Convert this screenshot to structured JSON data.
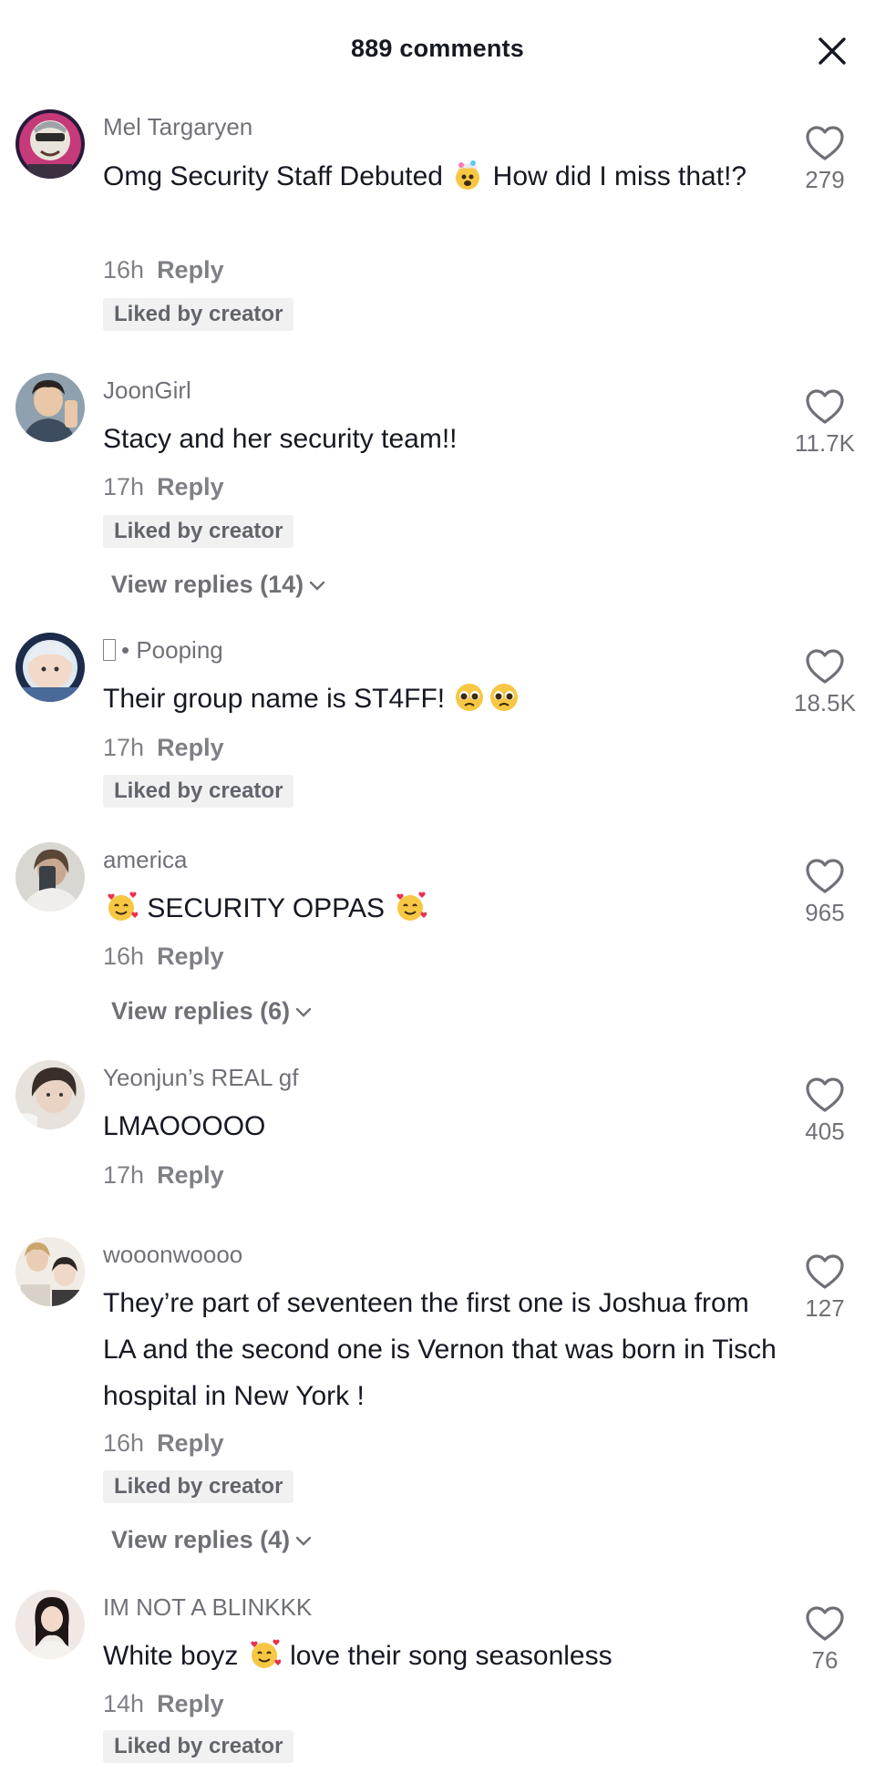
{
  "header": {
    "title": "889 comments"
  },
  "comments": [
    {
      "username": "Mel Targaryen",
      "text_a": "Omg Security Staff Debuted",
      "text_b": " How did I miss that!?",
      "time": "16h",
      "reply": "Reply",
      "liked_label": "Liked by creator",
      "likes": "279"
    },
    {
      "username": "JoonGirl",
      "text_a": "Stacy and her security team!!",
      "time": "17h",
      "reply": "Reply",
      "liked_label": "Liked by creator",
      "view_replies": "View replies (14)",
      "likes": "11.7K"
    },
    {
      "username": "• Pooping",
      "text_a": "Their group name is ST4FF! ",
      "time": "17h",
      "reply": "Reply",
      "liked_label": "Liked by creator",
      "likes": "18.5K"
    },
    {
      "username": "america",
      "text_a": " SECURITY OPPAS ",
      "time": "16h",
      "reply": "Reply",
      "view_replies": "View replies (6)",
      "likes": "965"
    },
    {
      "username": "Yeonjun’s REAL gf",
      "text_a": "LMAOOOOO",
      "time": "17h",
      "reply": "Reply",
      "likes": "405"
    },
    {
      "username": "wooonwoooo",
      "text_a": "They’re part of seventeen the first one is Joshua from LA and the second one is Vernon that was born in Tisch hospital in New York !",
      "time": "16h",
      "reply": "Reply",
      "liked_label": "Liked by creator",
      "view_replies": "View replies (4)",
      "likes": "127"
    },
    {
      "username": "IM NOT A BLINKKK",
      "text_a": "White boyz ",
      "text_b": " love their song seasonless",
      "time": "14h",
      "reply": "Reply",
      "liked_label": "Liked by creator",
      "likes": "76"
    }
  ],
  "icons": {
    "close": "close-icon",
    "heart": "heart-outline-icon",
    "chevron": "chevron-down-icon"
  }
}
